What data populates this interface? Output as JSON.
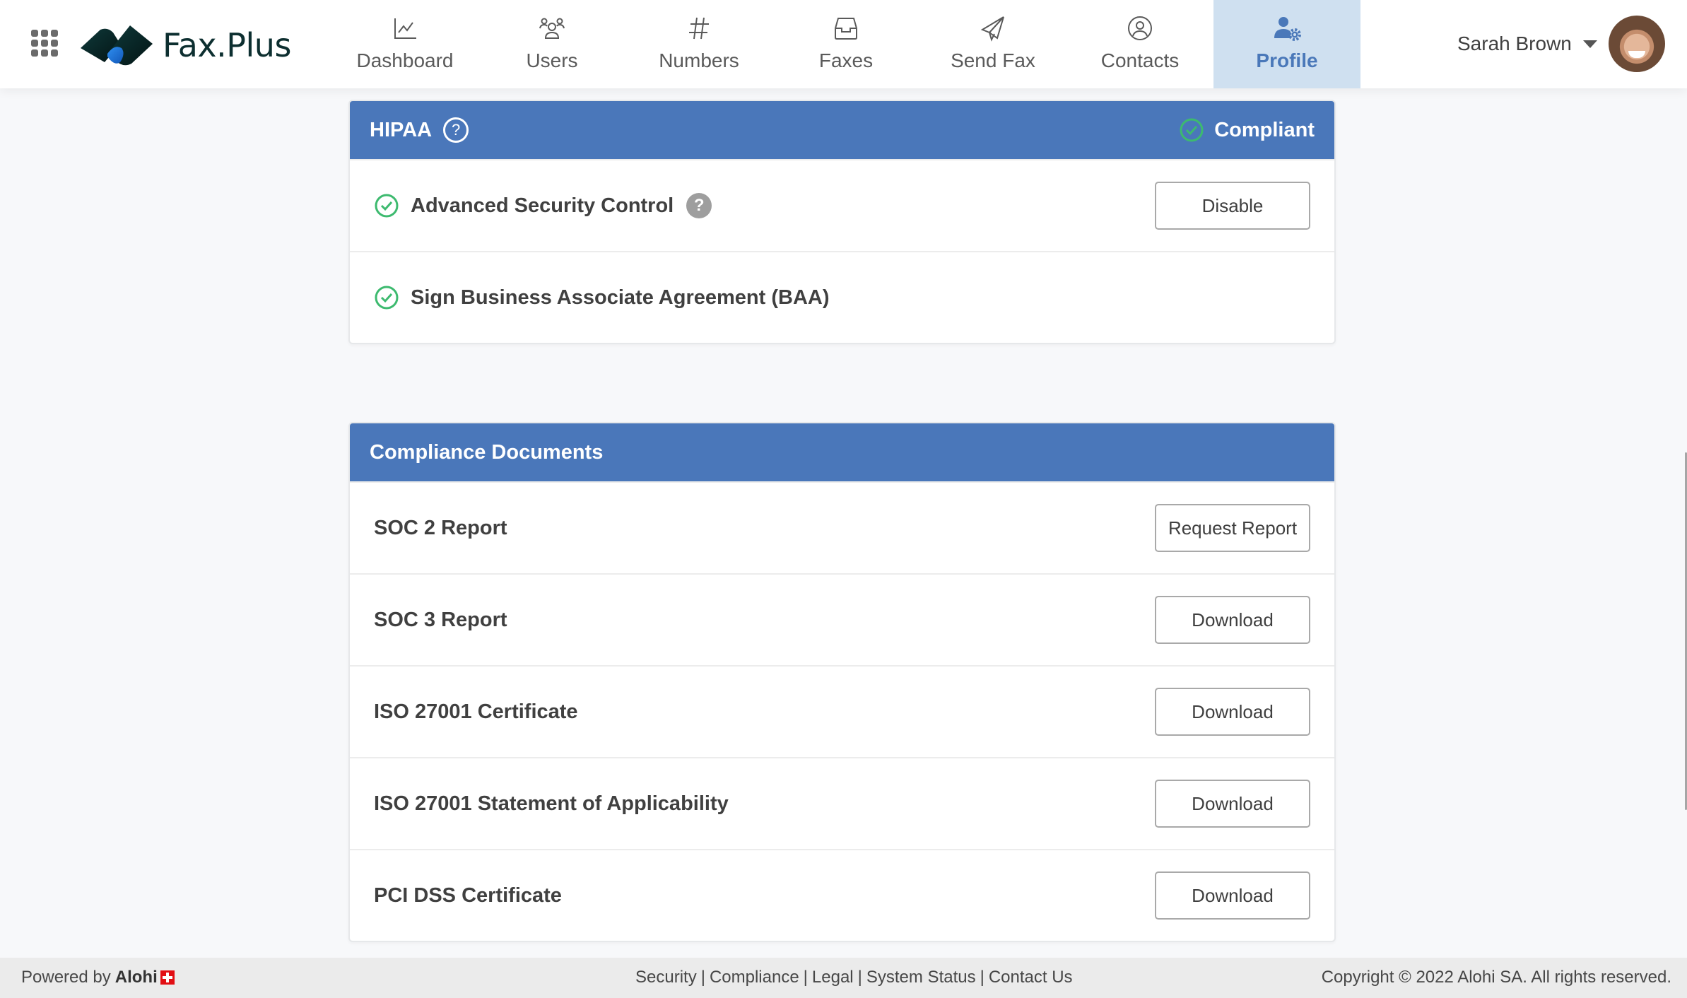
{
  "header": {
    "apps_icon": "grid-icon",
    "logo_text": "Fax.Plus",
    "nav": [
      {
        "label": "Dashboard",
        "icon": "chart-line-icon",
        "active": false
      },
      {
        "label": "Users",
        "icon": "users-icon",
        "active": false
      },
      {
        "label": "Numbers",
        "icon": "hash-icon",
        "active": false
      },
      {
        "label": "Faxes",
        "icon": "inbox-icon",
        "active": false
      },
      {
        "label": "Send Fax",
        "icon": "paper-plane-icon",
        "active": false
      },
      {
        "label": "Contacts",
        "icon": "user-circle-icon",
        "active": false
      },
      {
        "label": "Profile",
        "icon": "user-gear-icon",
        "active": true
      }
    ],
    "user": {
      "name": "Sarah Brown"
    }
  },
  "hipaa": {
    "title": "HIPAA",
    "status": "Compliant",
    "rows": [
      {
        "label": "Advanced Security Control",
        "checked": true,
        "has_help": true,
        "button": "Disable"
      },
      {
        "label": "Sign Business Associate Agreement (BAA)",
        "checked": true,
        "has_help": false
      }
    ]
  },
  "compliance": {
    "title": "Compliance Documents",
    "rows": [
      {
        "label": "SOC 2 Report",
        "button": "Request Report"
      },
      {
        "label": "SOC 3 Report",
        "button": "Download"
      },
      {
        "label": "ISO 27001 Certificate",
        "button": "Download"
      },
      {
        "label": "ISO 27001 Statement of Applicability",
        "button": "Download"
      },
      {
        "label": "PCI DSS Certificate",
        "button": "Download"
      }
    ]
  },
  "footer": {
    "powered_by": "Powered by",
    "brand": "Alohi",
    "links": [
      "Security",
      "Compliance",
      "Legal",
      "System Status",
      "Contact Us"
    ],
    "separator": "|",
    "copyright": "Copyright © 2022 Alohi SA. All rights reserved."
  },
  "colors": {
    "accent": "#4a77ba",
    "active_tab_bg": "#cfe0f0",
    "success": "#3dba6f",
    "logo_dark": "#0d2f30"
  }
}
